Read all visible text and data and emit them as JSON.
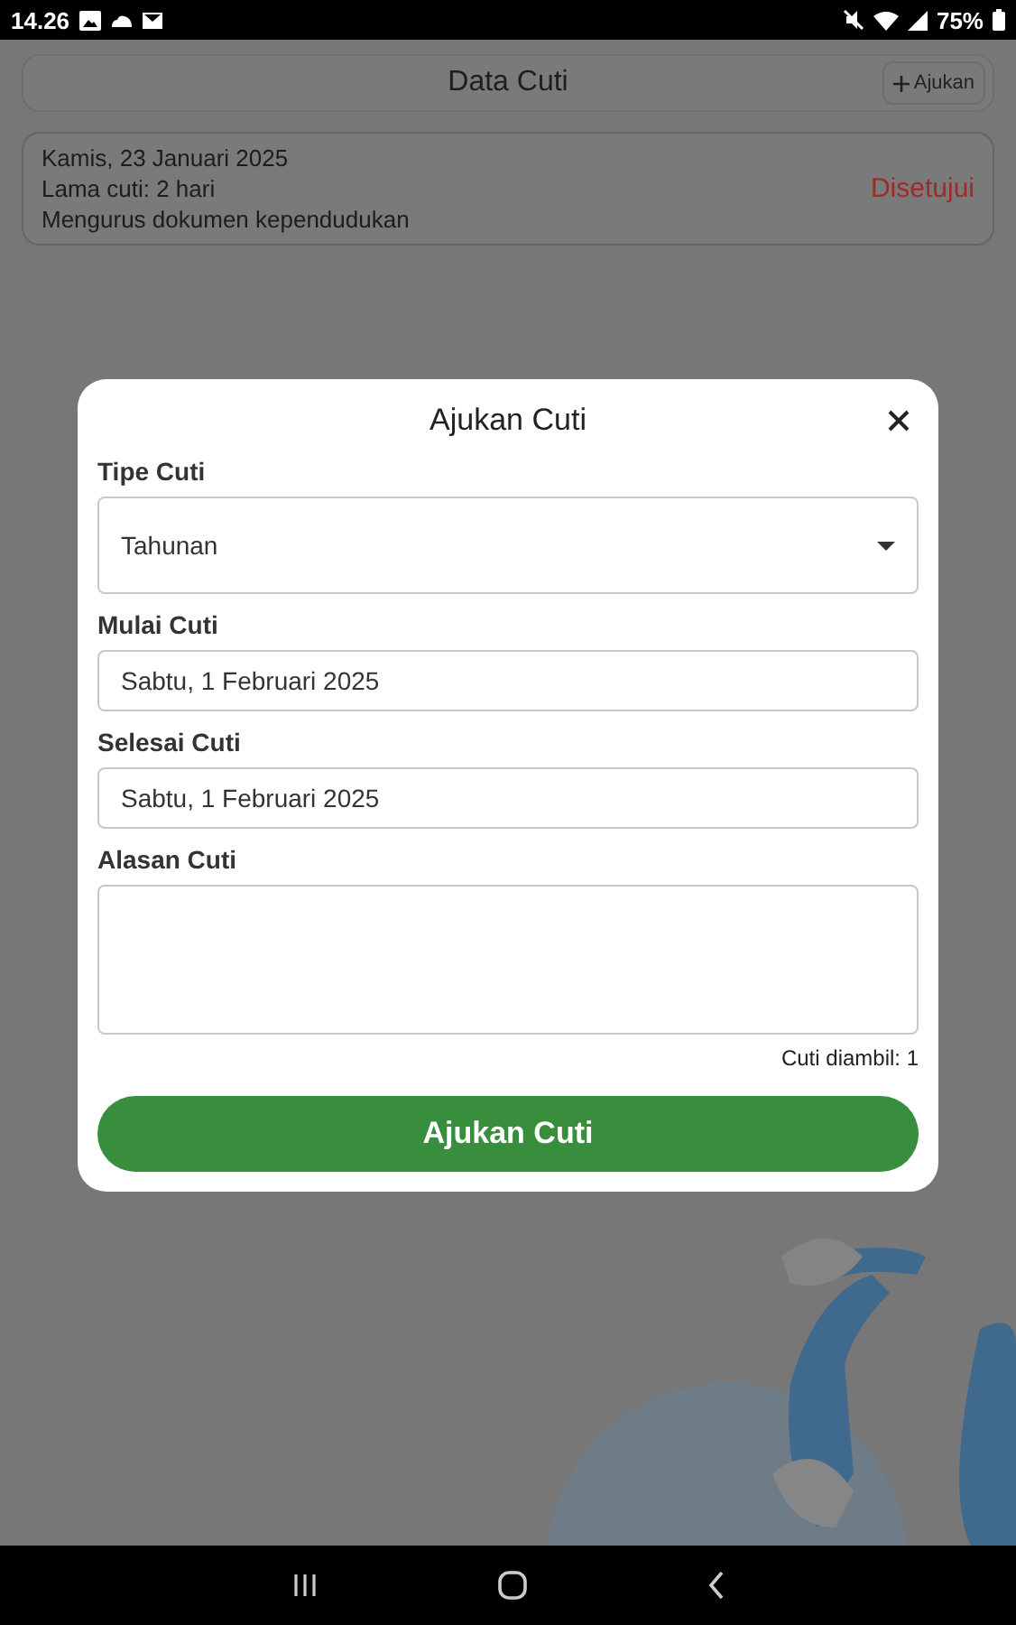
{
  "status_bar": {
    "time": "14.26",
    "battery": "75%"
  },
  "header": {
    "title": "Data Cuti",
    "add_button": "Ajukan"
  },
  "leaves": [
    {
      "date": "Kamis, 23 Januari 2025",
      "duration": "Lama cuti: 2 hari",
      "reason": "Mengurus dokumen kependudukan",
      "status": "Disetujui"
    }
  ],
  "dialog": {
    "title": "Ajukan Cuti",
    "fields": [
      {
        "kind": "select",
        "label": "Tipe Cuti",
        "value": "Tahunan"
      },
      {
        "kind": "date",
        "label": "Mulai Cuti",
        "value": "Sabtu, 1 Februari 2025"
      },
      {
        "kind": "date",
        "label": "Selesai Cuti",
        "value": "Sabtu, 1 Februari 2025"
      },
      {
        "kind": "textarea",
        "label": "Alasan Cuti"
      }
    ],
    "counter": "Cuti diambil: 1",
    "submit": "Ajukan Cuti"
  }
}
